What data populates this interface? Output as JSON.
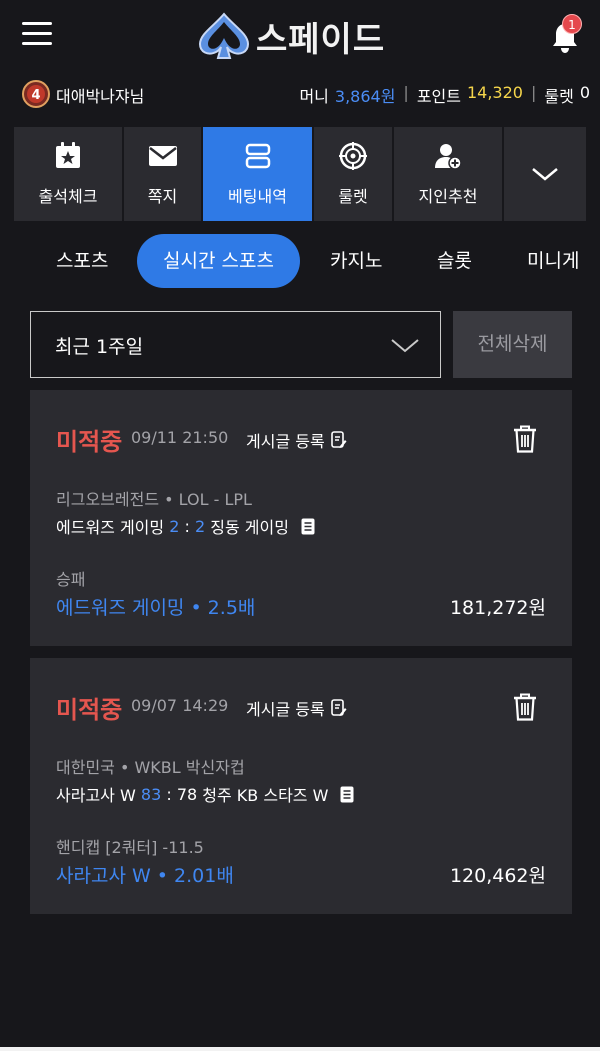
{
  "header": {
    "logo_text": "스페이드",
    "notification_count": "1"
  },
  "user": {
    "level": "4",
    "name": "대애박나쟈님",
    "money_label": "머니",
    "money_value": "3,864원",
    "point_label": "포인트",
    "point_value": "14,320",
    "roulette_label": "룰렛",
    "roulette_value": "0"
  },
  "quick_menu": [
    {
      "label": "출석체크",
      "icon": "calendar-star-icon"
    },
    {
      "label": "쪽지",
      "icon": "envelope-icon"
    },
    {
      "label": "베팅내역",
      "icon": "list-icon",
      "active": true
    },
    {
      "label": "룰렛",
      "icon": "roulette-icon"
    },
    {
      "label": "지인추천",
      "icon": "add-user-icon"
    },
    {
      "label": "",
      "icon": "chevron-down-icon"
    }
  ],
  "tabs": [
    "스포츠",
    "실시간 스포츠",
    "카지노",
    "슬롯",
    "미니게"
  ],
  "active_tab": "실시간 스포츠",
  "filter": {
    "period": "최근 1주일",
    "delete_all": "전체삭제"
  },
  "bets": [
    {
      "status": "미적중",
      "datetime": "09/11 21:50",
      "post_label": "게시글 등록",
      "league": "리그오브레전드  •  LOL - LPL",
      "home_team": "에드워즈 게이밍",
      "home_score": "2",
      "score_sep": ":",
      "away_score": "2",
      "away_team": "징동 게이밍",
      "market": "승패",
      "pick": "에드워즈 게이밍  •  2.5배",
      "amount": "181,272원"
    },
    {
      "status": "미적중",
      "datetime": "09/07 14:29",
      "post_label": "게시글 등록",
      "league": "대한민국  •  WKBL 박신자컵",
      "home_team": "사라고사 W",
      "home_score": "83",
      "score_sep": ":",
      "away_score": "78",
      "away_team": "청주 KB 스타즈 W",
      "market": "핸디캡 [2쿼터] -11.5",
      "pick": "사라고사 W  •  2.01배",
      "amount": "120,462원"
    }
  ],
  "colors": {
    "background": "#17171b",
    "card": "#2b2b30",
    "accent": "#2f7ae6",
    "lost": "#e5564f",
    "money": "#4b8df5",
    "point": "#f6d64b"
  }
}
